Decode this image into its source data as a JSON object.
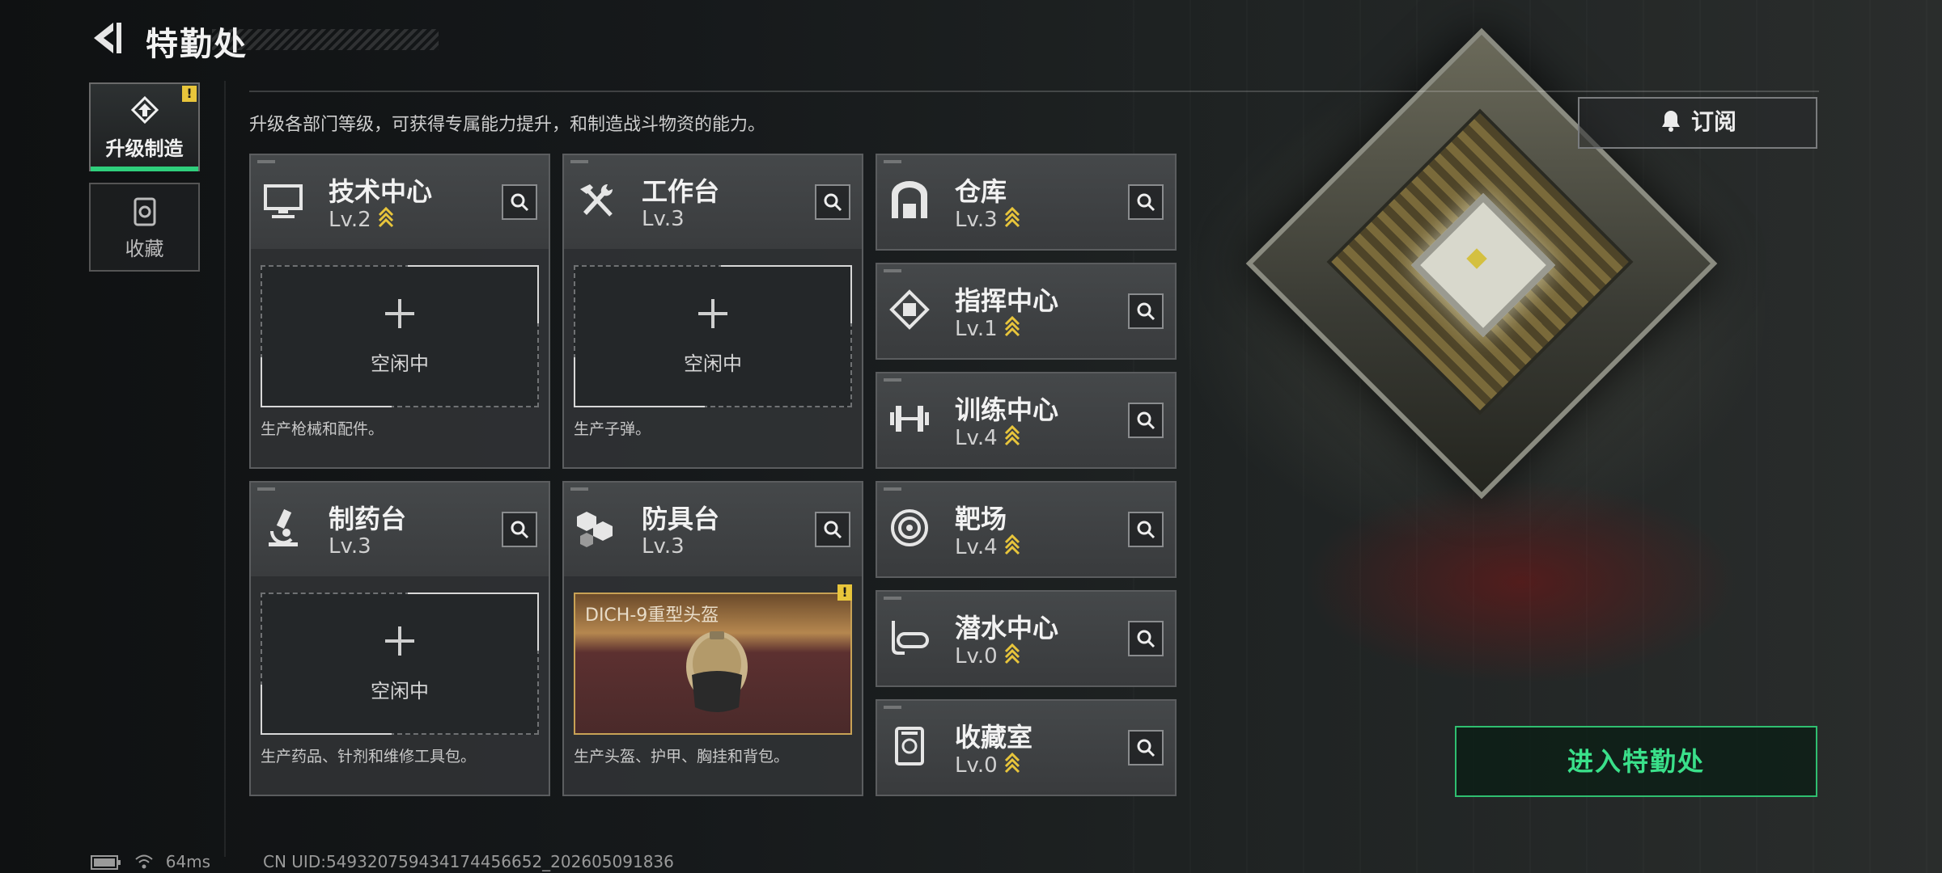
{
  "header": {
    "title": "特勤处"
  },
  "description": "升级各部门等级，可获得专属能力提升，和制造战斗物资的能力。",
  "tabs": [
    {
      "label": "升级制造",
      "active": true,
      "warning": "!"
    },
    {
      "label": "收藏",
      "active": false
    }
  ],
  "production_cards": [
    {
      "name": "技术中心",
      "level": "Lv.2",
      "slot_status": "空闲中",
      "description": "生产枪械和配件。"
    },
    {
      "name": "工作台",
      "level": "Lv.3",
      "slot_status": "空闲中",
      "description": "生产子弹。"
    },
    {
      "name": "制药台",
      "level": "Lv.3",
      "slot_status": "空闲中",
      "description": "生产药品、针剂和维修工具包。"
    },
    {
      "name": "防具台",
      "level": "Lv.3",
      "crafting_item": "DICH-9重型头盔",
      "warning": "!",
      "description": "生产头盔、护甲、胸挂和背包。"
    }
  ],
  "facilities": [
    {
      "name": "仓库",
      "level": "Lv.3",
      "icon": "warehouse-icon"
    },
    {
      "name": "指挥中心",
      "level": "Lv.1",
      "icon": "command-icon"
    },
    {
      "name": "训练中心",
      "level": "Lv.4",
      "icon": "dumbbell-icon"
    },
    {
      "name": "靶场",
      "level": "Lv.4",
      "icon": "target-icon"
    },
    {
      "name": "潜水中心",
      "level": "Lv.0",
      "icon": "diving-mask-icon"
    },
    {
      "name": "收藏室",
      "level": "Lv.0",
      "icon": "collection-icon"
    }
  ],
  "buttons": {
    "subscribe": "订阅",
    "enter": "进入特勤处"
  },
  "status_bar": {
    "ping": "64ms",
    "uid": "CN UID:549320759434174456652_202605091836"
  },
  "colors": {
    "accent_green": "#2fcf7c",
    "warning_yellow": "#e8c53b",
    "upgrade_chevron": "#e8c53b"
  }
}
